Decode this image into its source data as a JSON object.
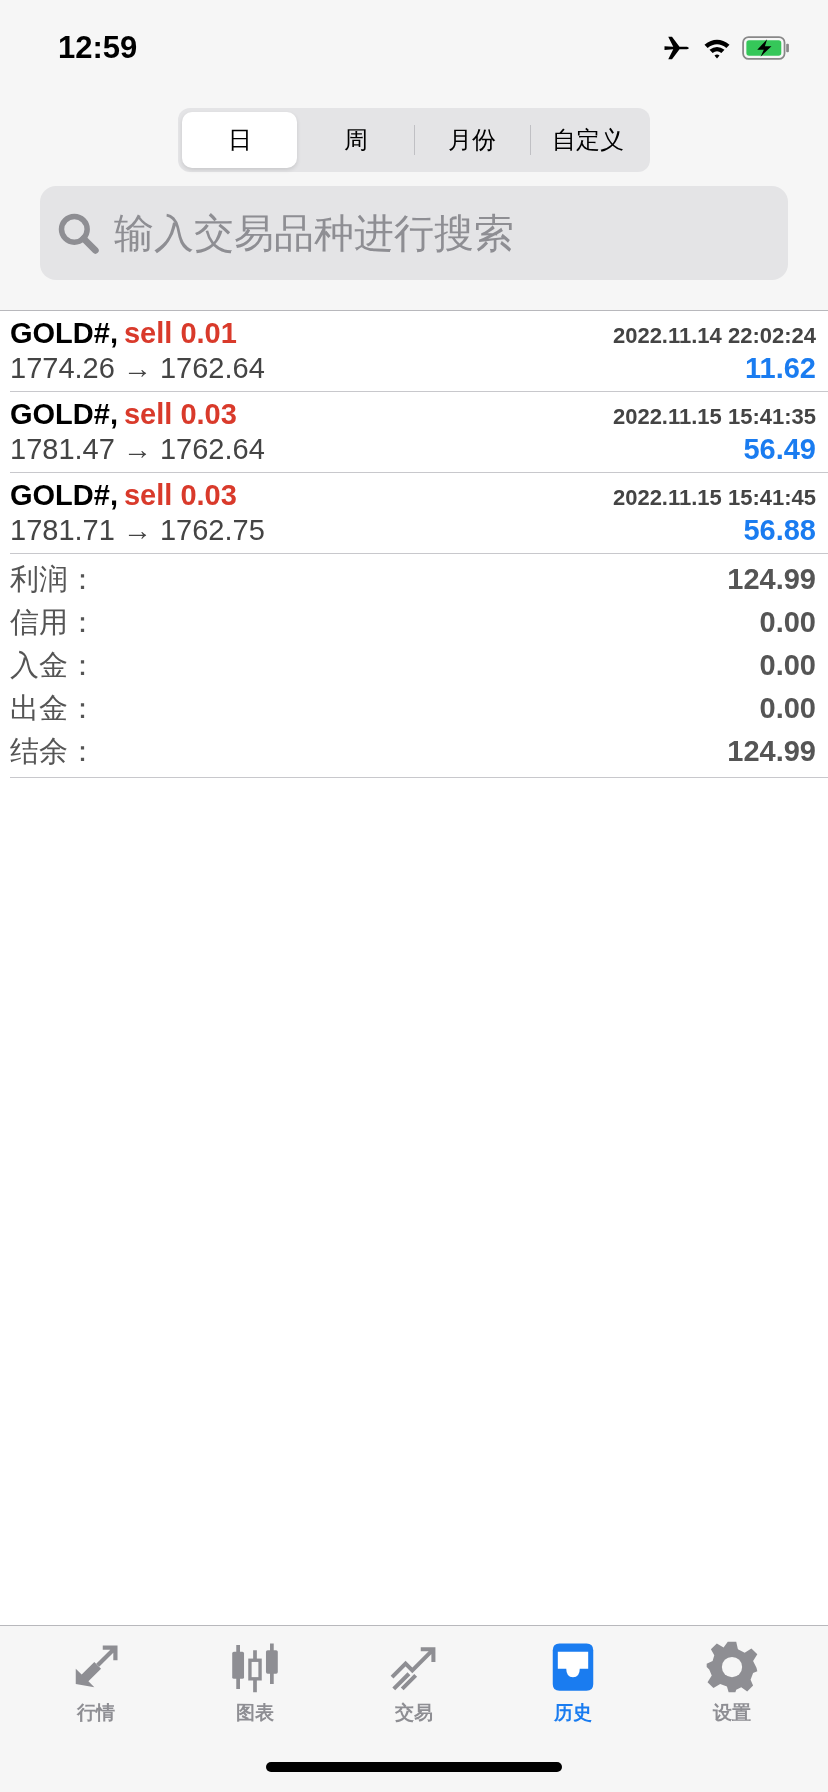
{
  "status_bar": {
    "time": "12:59"
  },
  "period_tabs": [
    {
      "label": "日",
      "selected": true
    },
    {
      "label": "周",
      "selected": false
    },
    {
      "label": "月份",
      "selected": false
    },
    {
      "label": "自定义",
      "selected": false
    }
  ],
  "search": {
    "placeholder": "输入交易品种进行搜索"
  },
  "deals": [
    {
      "symbol": "GOLD#,",
      "order": "sell 0.01",
      "time": "2022.11.14 22:02:24",
      "prices": "1774.26 → 1762.64",
      "profit": "11.62"
    },
    {
      "symbol": "GOLD#,",
      "order": "sell 0.03",
      "time": "2022.11.15 15:41:35",
      "prices": "1781.47 → 1762.64",
      "profit": "56.49"
    },
    {
      "symbol": "GOLD#,",
      "order": "sell 0.03",
      "time": "2022.11.15 15:41:45",
      "prices": "1781.71 → 1762.75",
      "profit": "56.88"
    }
  ],
  "summary": [
    {
      "label": "利润：",
      "value": "124.99"
    },
    {
      "label": "信用：",
      "value": "0.00"
    },
    {
      "label": "入金：",
      "value": "0.00"
    },
    {
      "label": "出金：",
      "value": "0.00"
    },
    {
      "label": "结余：",
      "value": "124.99"
    }
  ],
  "tab_bar": [
    {
      "kind": "quotes",
      "label": "行情",
      "selected": false
    },
    {
      "kind": "chart",
      "label": "图表",
      "selected": false
    },
    {
      "kind": "trade",
      "label": "交易",
      "selected": false
    },
    {
      "kind": "history",
      "label": "历史",
      "selected": true
    },
    {
      "kind": "settings",
      "label": "设置",
      "selected": false
    }
  ]
}
